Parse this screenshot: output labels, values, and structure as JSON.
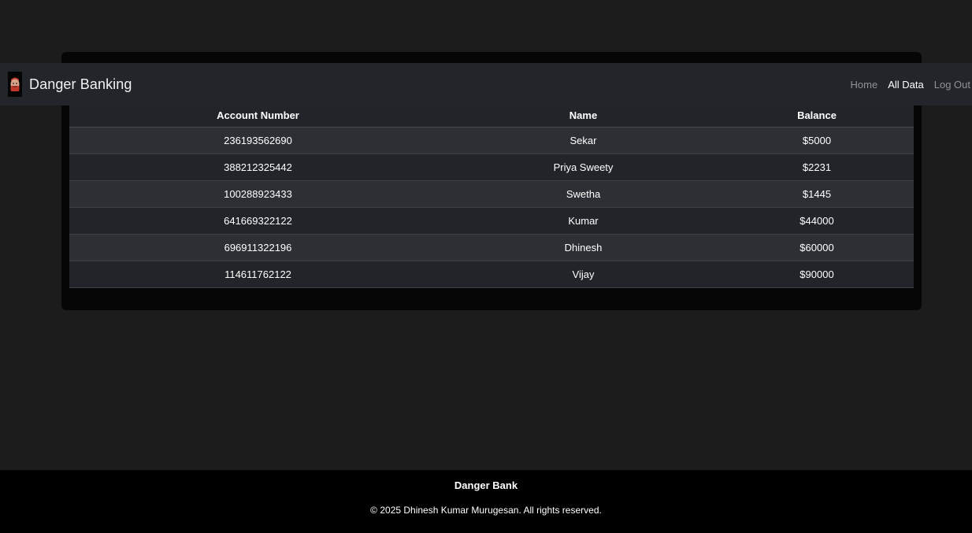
{
  "brand": {
    "name": "Danger Banking",
    "logo_icon": "dali-mask-icon"
  },
  "nav": {
    "links": [
      {
        "label": "Home",
        "active": false
      },
      {
        "label": "All Data",
        "active": true
      },
      {
        "label": "Log Out",
        "active": false
      }
    ]
  },
  "table": {
    "headers": [
      "Account Number",
      "Name",
      "Balance"
    ],
    "rows": [
      [
        "236193562690",
        "Sekar",
        "$5000"
      ],
      [
        "388212325442",
        "Priya Sweety",
        "$2231"
      ],
      [
        "100288923433",
        "Swetha",
        "$1445"
      ],
      [
        "641669322122",
        "Kumar",
        "$44000"
      ],
      [
        "696911322196",
        "Dhinesh",
        "$60000"
      ],
      [
        "114611762122",
        "Vijay",
        "$90000"
      ]
    ]
  },
  "footer": {
    "title": "Danger Bank",
    "copyright": "© 2025 Dhinesh Kumar Murugesan. All rights reserved."
  },
  "colors": {
    "page_background": "#1c1c1c",
    "navbar_background": "#22252a",
    "table_row_odd": "#2c3034",
    "table_row_even": "#212529",
    "footer_background": "#000000"
  }
}
